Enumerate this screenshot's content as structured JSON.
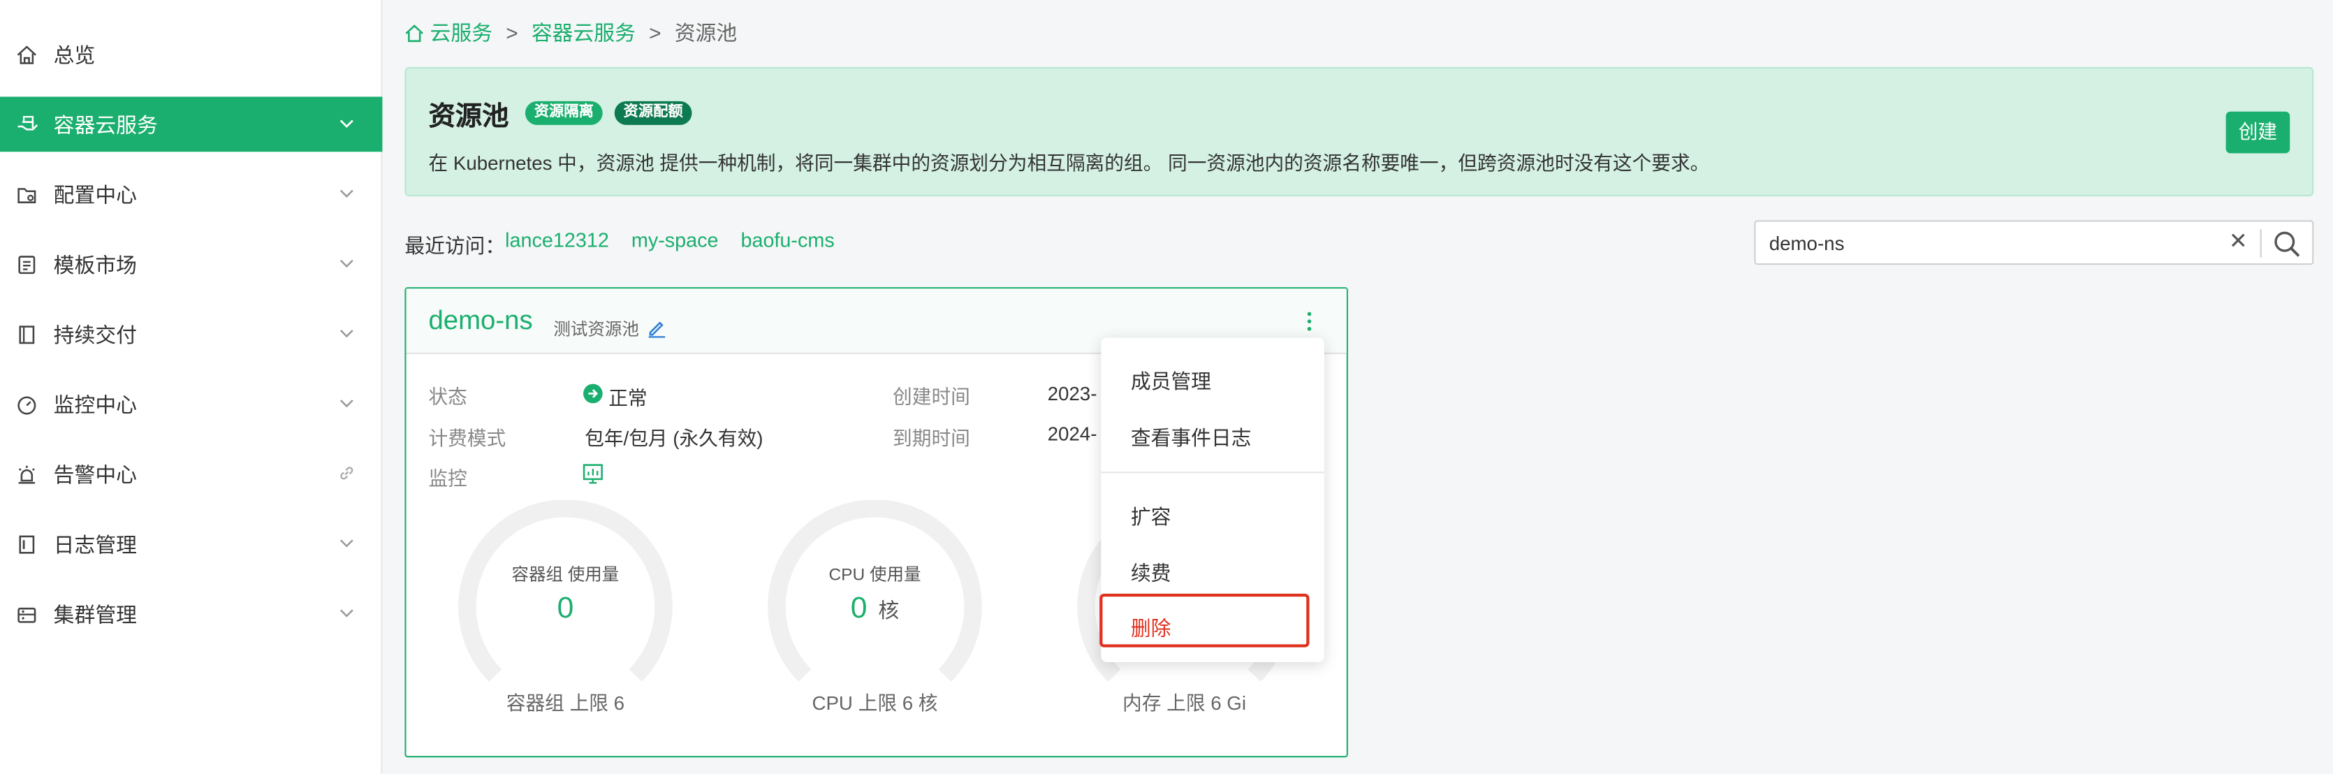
{
  "sidebar": {
    "items": [
      {
        "label": "总览",
        "icon": "home-icon"
      },
      {
        "label": "容器云服务",
        "icon": "cloud-hand-icon",
        "active": true
      },
      {
        "label": "配置中心",
        "icon": "folder-gear-icon"
      },
      {
        "label": "模板市场",
        "icon": "template-icon"
      },
      {
        "label": "持续交付",
        "icon": "document-icon"
      },
      {
        "label": "监控中心",
        "icon": "dashboard-icon"
      },
      {
        "label": "告警中心",
        "icon": "alarm-icon"
      },
      {
        "label": "日志管理",
        "icon": "log-icon"
      },
      {
        "label": "集群管理",
        "icon": "cluster-icon"
      }
    ]
  },
  "breadcrumb": {
    "home": "云服务",
    "sep": ">",
    "level2": "容器云服务",
    "current": "资源池"
  },
  "banner": {
    "title": "资源池",
    "badge1": "资源隔离",
    "badge2": "资源配额",
    "description": "在 Kubernetes 中，资源池 提供一种机制，将同一集群中的资源划分为相互隔离的组。 同一资源池内的资源名称要唯一，但跨资源池时没有这个要求。",
    "create_label": "创建"
  },
  "recent": {
    "label": "最近访问：",
    "links": [
      "lance12312",
      "my-space",
      "baofu-cms"
    ]
  },
  "search": {
    "value": "demo-ns",
    "placeholder": ""
  },
  "card": {
    "name": "demo-ns",
    "subtitle": "测试资源池",
    "status_label": "状态",
    "status_value": "正常",
    "billing_label": "计费模式",
    "billing_value": "包年/包月 (永久有效)",
    "monitor_label": "监控",
    "created_label": "创建时间",
    "created_value": "2023-",
    "expire_label": "到期时间",
    "expire_value": "2024-",
    "gauges": [
      {
        "title": "容器组 使用量",
        "value": "0",
        "unit": "",
        "limit": "容器组 上限 6"
      },
      {
        "title": "CPU 使用量",
        "value": "0",
        "unit": "核",
        "limit": "CPU 上限 6 核"
      },
      {
        "title": "",
        "value": "",
        "unit": "",
        "limit": "内存 上限 6 Gi"
      }
    ]
  },
  "menu": {
    "items": [
      "成员管理",
      "查看事件日志",
      "扩容",
      "续费",
      "删除"
    ]
  },
  "colors": {
    "accent": "#1aaf6e",
    "danger": "#e0301e",
    "badge_dark": "#0e7a52"
  }
}
